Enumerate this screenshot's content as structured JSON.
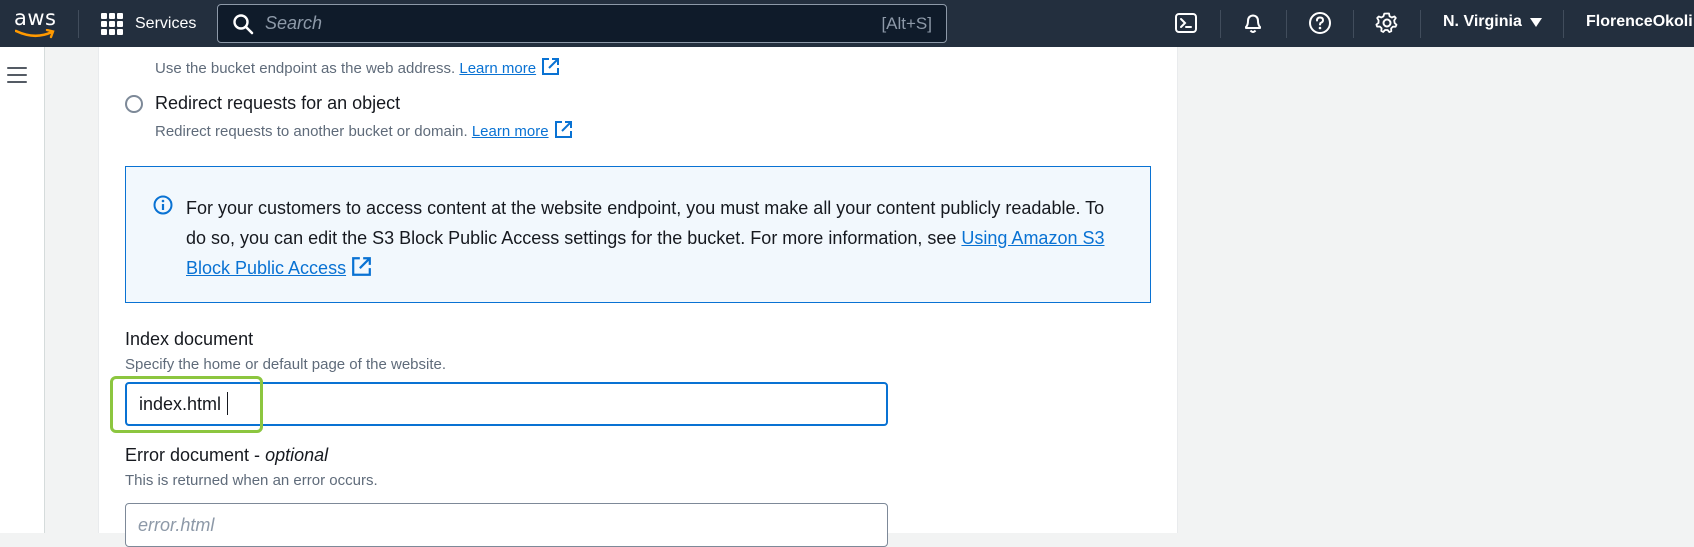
{
  "topnav": {
    "logo_text": "aws",
    "services_label": "Services",
    "search_placeholder": "Search",
    "search_shortcut": "[Alt+S]",
    "region": "N. Virginia",
    "user": "FlorenceOkoli"
  },
  "content": {
    "host_desc": "Use the bucket endpoint as the web address.",
    "host_link": "Learn more",
    "redirect_label": "Redirect requests for an object",
    "redirect_desc": "Redirect requests to another bucket or domain.",
    "redirect_link": "Learn more",
    "info_text": "For your customers to access content at the website endpoint, you must make all your content publicly readable. To do so, you can edit the S3 Block Public Access settings for the bucket. For more information, see",
    "info_link": "Using Amazon S3 Block Public Access",
    "index_label": "Index document",
    "index_desc": "Specify the home or default page of the website.",
    "index_value": "index.html",
    "error_label": "Error document -",
    "error_optional": "optional",
    "error_desc": "This is returned when an error occurs.",
    "error_placeholder": "error.html"
  },
  "colors": {
    "nav_bg": "#232f3e",
    "link": "#0972d3",
    "info_bg": "#f2f8fd",
    "highlight": "#8cc63f"
  }
}
